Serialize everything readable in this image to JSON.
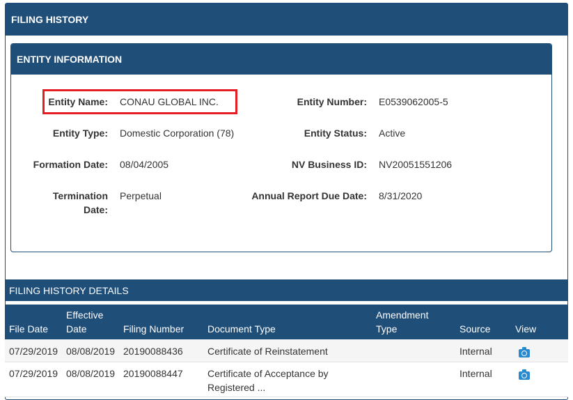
{
  "page": {
    "title": "FILING HISTORY"
  },
  "entity_panel": {
    "title": "ENTITY INFORMATION",
    "fields": {
      "entity_name_label": "Entity Name:",
      "entity_name_value": "CONAU GLOBAL INC.",
      "entity_number_label": "Entity Number:",
      "entity_number_value": "E0539062005-5",
      "entity_type_label": "Entity Type:",
      "entity_type_value": "Domestic Corporation (78)",
      "entity_status_label": "Entity Status:",
      "entity_status_value": "Active",
      "formation_date_label": "Formation Date:",
      "formation_date_value": "08/04/2005",
      "nv_business_id_label": "NV Business ID:",
      "nv_business_id_value": "NV20051551206",
      "termination_date_label_line1": "Termination",
      "termination_date_label_line2": "Date:",
      "termination_date_value": "Perpetual",
      "annual_report_label": "Annual Report Due Date:",
      "annual_report_value": "8/31/2020"
    }
  },
  "filing_details": {
    "title": "FILING HISTORY DETAILS",
    "columns": {
      "file_date": "File Date",
      "effective_date_line1": "Effective",
      "effective_date_line2": "Date",
      "filing_number": "Filing Number",
      "document_type": "Document Type",
      "amendment_type_line1": "Amendment",
      "amendment_type_line2": "Type",
      "source": "Source",
      "view": "View"
    },
    "rows": [
      {
        "file_date": "07/29/2019",
        "effective_date": "08/08/2019",
        "filing_number": "20190088436",
        "document_type_line1": "Certificate of Reinstatement",
        "document_type_line2": "",
        "amendment_type": "",
        "source": "Internal",
        "view_icon": "camera-icon"
      },
      {
        "file_date": "07/29/2019",
        "effective_date": "08/08/2019",
        "filing_number": "20190088447",
        "document_type_line1": "Certificate of Acceptance by",
        "document_type_line2": "Registered ...",
        "amendment_type": "",
        "source": "Internal",
        "view_icon": "camera-icon"
      }
    ]
  },
  "colors": {
    "header_blue": "#1f4e79",
    "highlight_red": "#e41c24",
    "icon_blue": "#2a8ad0"
  }
}
